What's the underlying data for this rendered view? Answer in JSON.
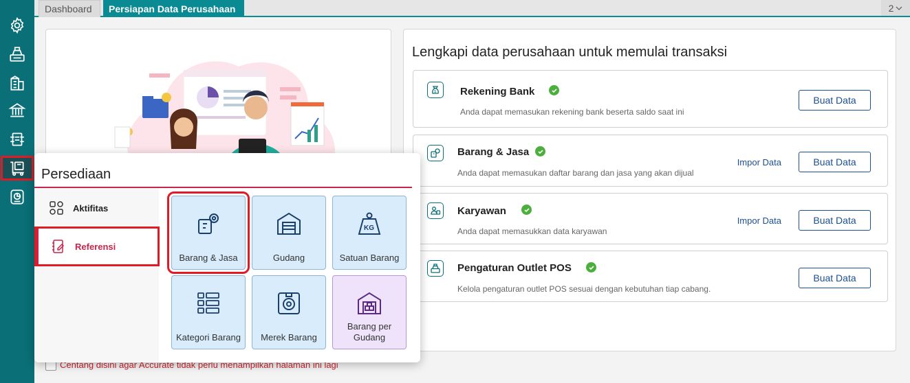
{
  "tabs": {
    "dashboard": "Dashboard",
    "active": "Persiapan Data Perusahaan",
    "count": "2",
    "count_icon": "chevron-down-icon"
  },
  "rail": {
    "icons": [
      "settings-icon",
      "cash-register-icon",
      "building-icon",
      "bank-icon",
      "transfer-icon",
      "inventory-icon",
      "report-icon"
    ],
    "active_index": 5
  },
  "right": {
    "heading": "Lengkapi data perusahaan untuk memulai transaksi",
    "rows": [
      {
        "title": "Rekening Bank",
        "desc": "Anda dapat memasukan rekening bank beserta saldo saat ini",
        "button": "Buat Data",
        "link": "",
        "icon": "money-bag-icon"
      },
      {
        "title": "Barang & Jasa",
        "desc": "Anda dapat memasukan daftar barang dan jasa yang akan dijual",
        "button": "Buat Data",
        "link": "Impor Data",
        "icon": "box-gear-icon"
      },
      {
        "title": "Karyawan",
        "desc": "Anda dapat memasukkan data karyawan",
        "button": "Buat Data",
        "link": "Impor Data",
        "icon": "employee-icon"
      },
      {
        "title": "Pengaturan Outlet POS",
        "desc": "Kelola pengaturan outlet POS sesuai dengan kebutuhan tiap cabang.",
        "button": "Buat Data",
        "link": "",
        "icon": "cash-register-icon"
      }
    ]
  },
  "footer": {
    "text": "Centang disini agar Accurate tidak perlu menampilkan halaman ini lagi"
  },
  "popup": {
    "title": "Persediaan",
    "side": {
      "aktifitas": "Aktifitas",
      "referensi": "Referensi"
    },
    "tiles": [
      {
        "label": "Barang & Jasa",
        "icon": "box-gear-icon"
      },
      {
        "label": "Gudang",
        "icon": "warehouse-icon"
      },
      {
        "label": "Satuan Barang",
        "icon": "kg-weight-icon"
      },
      {
        "label": "Kategori Barang",
        "icon": "category-grid-icon"
      },
      {
        "label": "Merek Barang",
        "icon": "brand-box-icon"
      },
      {
        "label": "Barang per Gudang",
        "icon": "warehouse-goods-icon"
      }
    ]
  },
  "colors": {
    "rail": "#0a6f77",
    "accent": "#0a8a92",
    "primary": "#1c4f8f",
    "check": "#4caf3d",
    "referensi": "#c8234a"
  }
}
